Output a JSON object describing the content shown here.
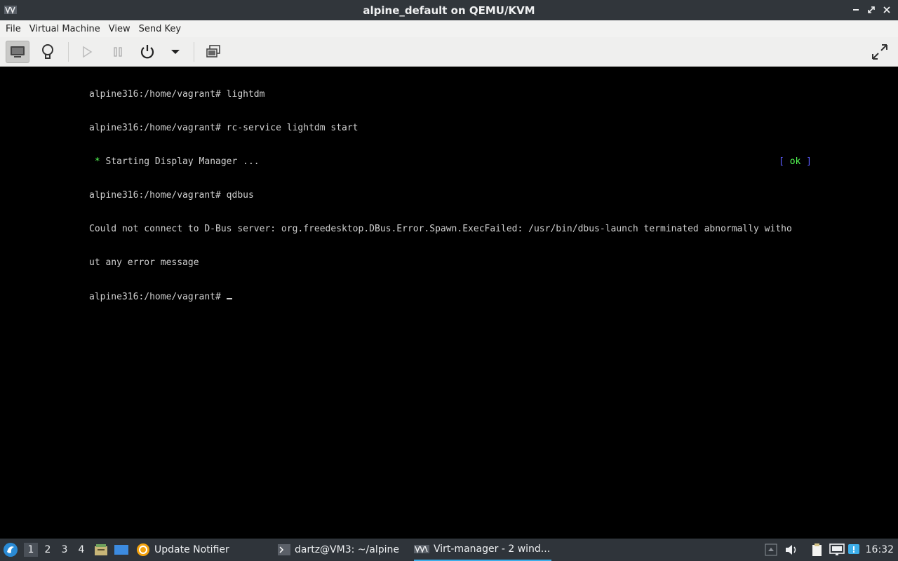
{
  "window": {
    "title": "alpine_default on QEMU/KVM",
    "controls": {
      "minimize": "–",
      "maximize": "◆",
      "close": "✕"
    }
  },
  "menubar": {
    "items": [
      "File",
      "Virtual Machine",
      "View",
      "Send Key"
    ]
  },
  "toolbar": {
    "icons": [
      "console-icon",
      "details-lightbulb-icon",
      "run-icon",
      "pause-icon",
      "power-icon",
      "dropdown-arrow-icon",
      "snapshots-icon",
      "fullscreen-icon"
    ]
  },
  "terminal": {
    "lines": [
      "alpine316:/home/vagrant# lightdm",
      "alpine316:/home/vagrant# rc-service lightdm start",
      " * Starting Display Manager ...",
      "alpine316:/home/vagrant# qdbus",
      "Could not connect to D-Bus server: org.freedesktop.DBus.Error.Spawn.ExecFailed: /usr/bin/dbus-launch terminated abnormally witho",
      "ut any error message",
      "alpine316:/home/vagrant# "
    ],
    "status_open": "[ ",
    "status_ok": "ok",
    "status_close": " ]",
    "colors": {
      "text": "#d0d0d0",
      "star": "#55ff55",
      "bracket": "#5c5cff",
      "background": "#000000"
    }
  },
  "taskbar": {
    "desktops": [
      "1",
      "2",
      "3",
      "4"
    ],
    "tasks": {
      "update_notifier": "Update Notifier",
      "terminal": "dartz@VM3: ~/alpine",
      "virt_manager": "Virt-manager - 2 wind..."
    },
    "clock": "16:32",
    "accent": "#3daee9"
  }
}
